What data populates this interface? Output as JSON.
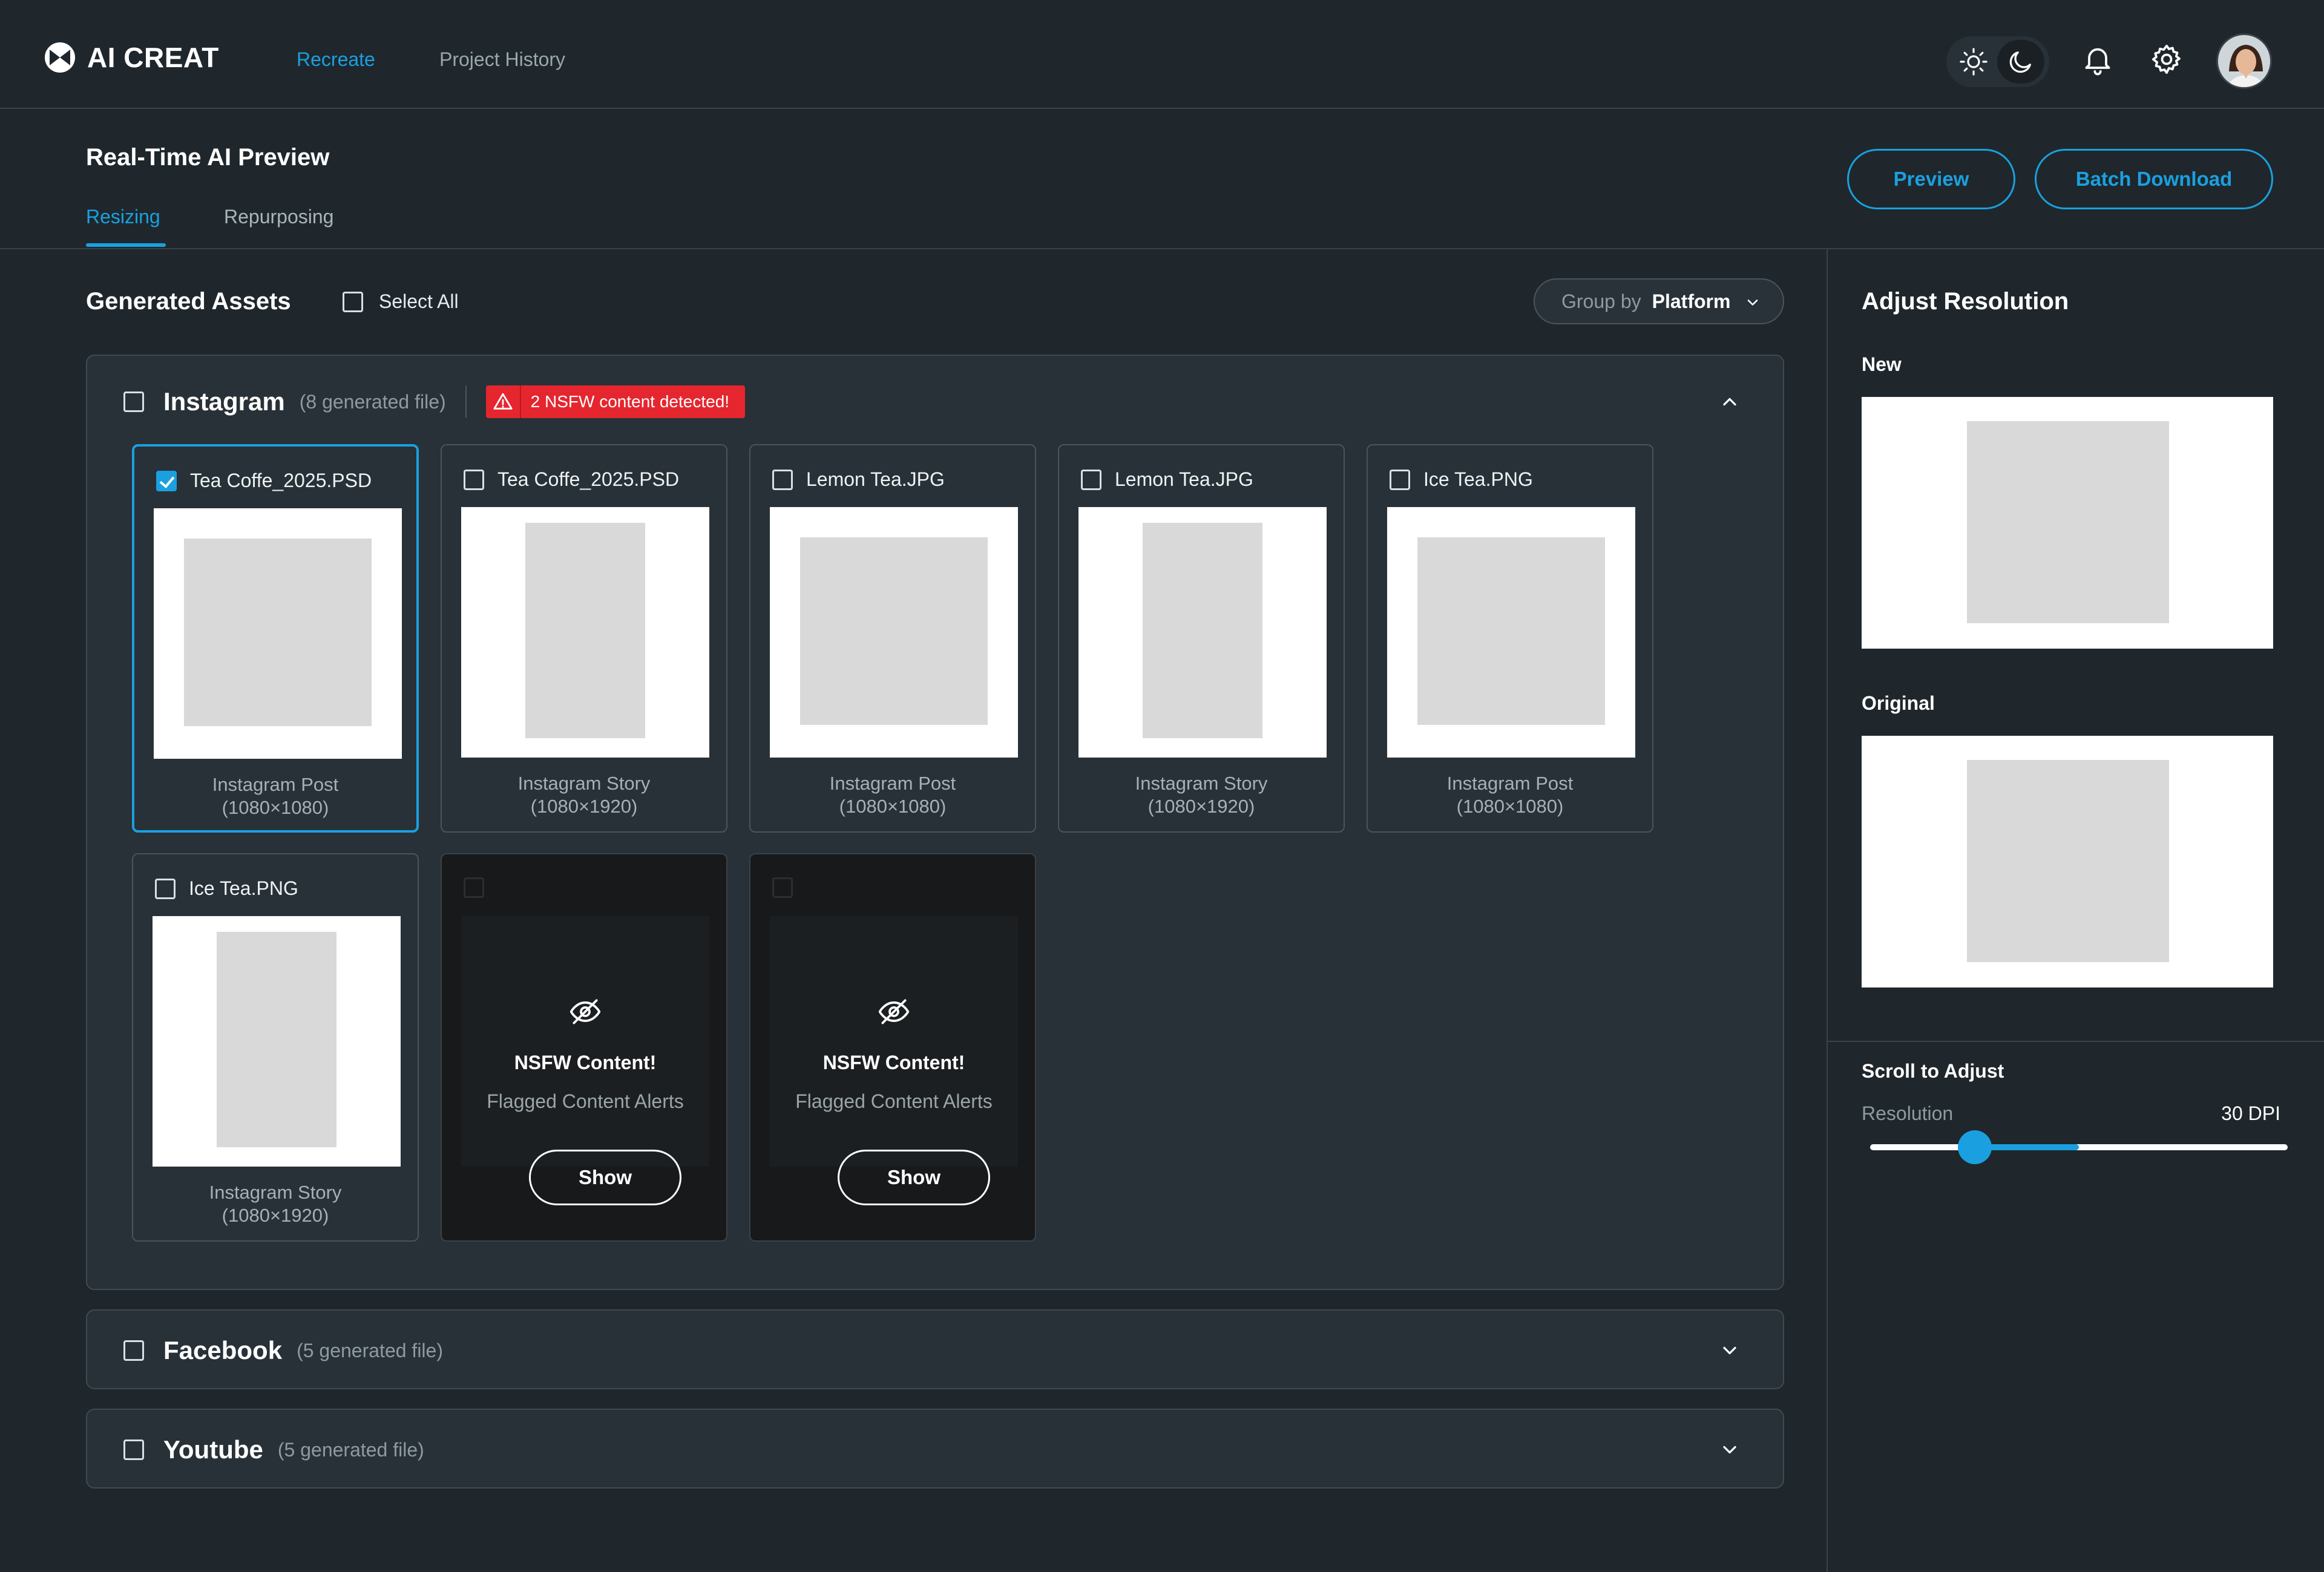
{
  "app": {
    "brand": "AI CREAT"
  },
  "nav": {
    "recreate": "Recreate",
    "project_history": "Project History"
  },
  "header": {
    "title": "Real-Time AI Preview",
    "tabs": [
      "Resizing",
      "Repurposing"
    ],
    "preview_btn": "Preview",
    "batch_download_btn": "Batch Download"
  },
  "assets": {
    "title": "Generated Assets",
    "select_all": "Select All",
    "group_by_label": "Group by",
    "group_by_value": "Platform"
  },
  "instagram": {
    "name": "Instagram",
    "count": "(8 generated file)",
    "nsfw_alert": "2 NSFW content detected!",
    "cards": [
      {
        "name": "Tea Coffe_2025.PSD",
        "type": "Instagram Post",
        "size": "(1080×1080)",
        "checked": true
      },
      {
        "name": "Tea Coffe_2025.PSD",
        "type": "Instagram Story",
        "size": "(1080×1920)",
        "checked": false
      },
      {
        "name": "Lemon Tea.JPG",
        "type": "Instagram Post",
        "size": "(1080×1080)",
        "checked": false
      },
      {
        "name": "Lemon Tea.JPG",
        "type": "Instagram Story",
        "size": "(1080×1920)",
        "checked": false
      },
      {
        "name": "Ice Tea.PNG",
        "type": "Instagram Post",
        "size": "(1080×1080)",
        "checked": false
      },
      {
        "name": "Ice Tea.PNG",
        "type": "Instagram Story",
        "size": "(1080×1920)",
        "checked": false
      }
    ],
    "nsfw_card": {
      "title": "NSFW Content!",
      "subtitle": "Flagged Content Alerts",
      "button": "Show"
    }
  },
  "facebook": {
    "name": "Facebook",
    "count": "(5 generated file)"
  },
  "youtube": {
    "name": "Youtube",
    "count": "(5 generated file)"
  },
  "right_panel": {
    "title": "Adjust Resolution",
    "new_label": "New",
    "original_label": "Original",
    "scroll_title": "Scroll to Adjust",
    "resolution_label": "Resolution",
    "resolution_value": "30 DPI",
    "slider_value": 0.25,
    "slider_fill": 0.5
  },
  "colors": {
    "accent": "#1aa0e0",
    "alert": "#e5262f",
    "background": "#1f272c"
  }
}
